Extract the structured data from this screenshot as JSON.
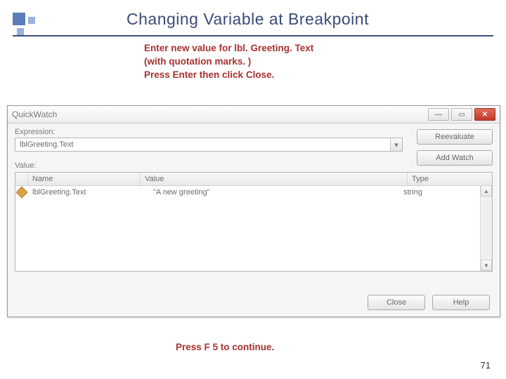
{
  "slide": {
    "title": "Changing Variable at Breakpoint",
    "page_number": "71",
    "instr_line1": "Enter new value for lbl. Greeting. Text",
    "instr_line2": "(with quotation marks. )",
    "instr_line3": "Press Enter then click Close.",
    "bottom_note": "Press F 5 to continue."
  },
  "quickwatch": {
    "title": "QuickWatch",
    "labels": {
      "expression": "Expression:",
      "value": "Value:"
    },
    "expression_value": "lblGreeting.Text",
    "buttons": {
      "reevaluate": "Reevaluate",
      "add_watch": "Add Watch",
      "close": "Close",
      "help": "Help"
    },
    "grid": {
      "headers": {
        "name": "Name",
        "value": "Value",
        "type": "Type"
      },
      "row": {
        "name": "lblGreeting.Text",
        "value": "\"A new greeting\"",
        "type": "string"
      }
    }
  }
}
